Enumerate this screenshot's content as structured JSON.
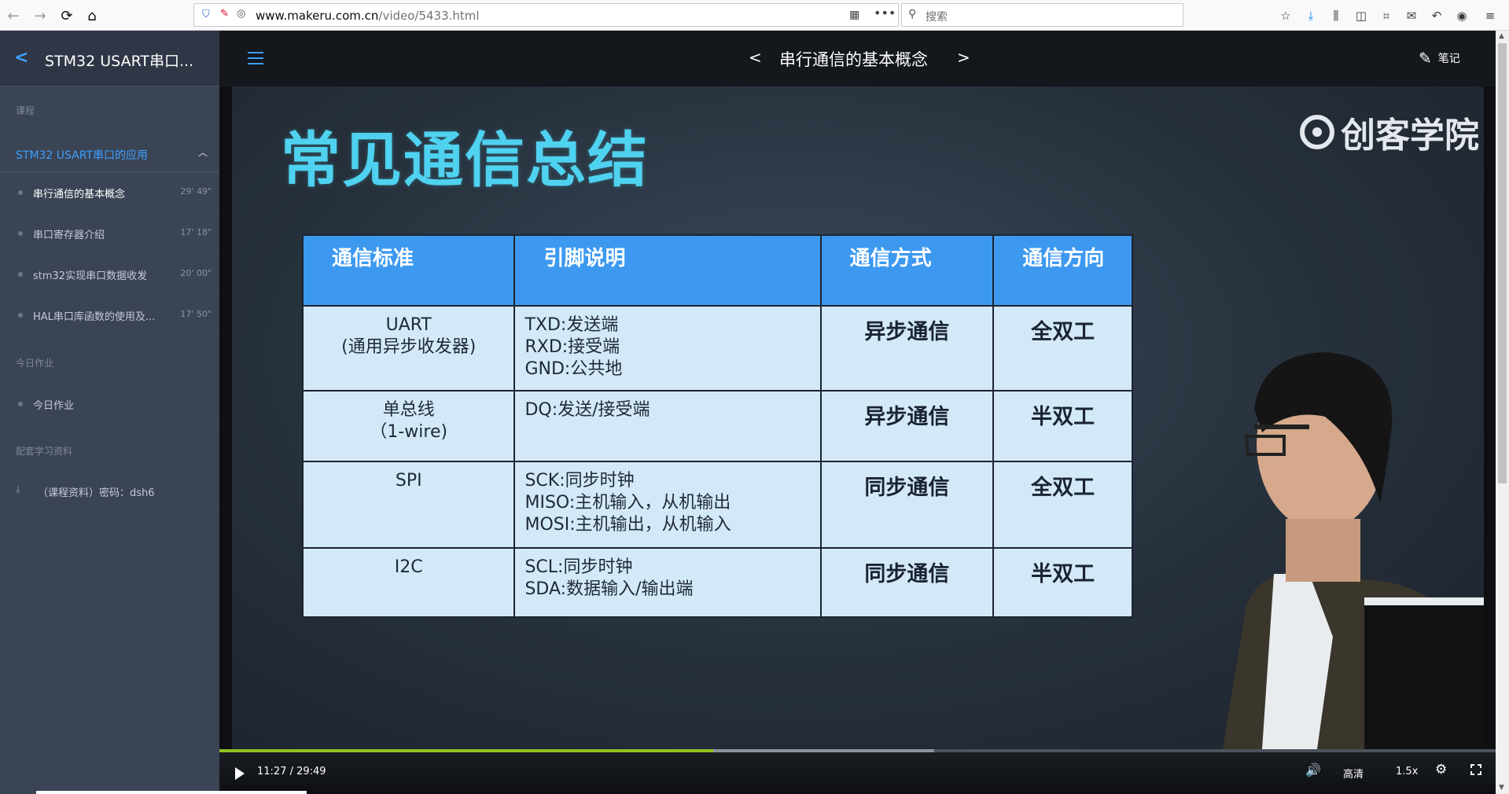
{
  "browser": {
    "url_host": "www.makeru.com.cn",
    "url_path": "/video/5433.html",
    "search_placeholder": "搜索"
  },
  "sidebar": {
    "title": "STM32 USART串口...",
    "section_course": "课程",
    "course_name": "STM32 USART串口的应用",
    "items": [
      {
        "label": "串行通信的基本概念",
        "duration": "29' 49\"",
        "active": true
      },
      {
        "label": "串口寄存器介绍",
        "duration": "17' 18\""
      },
      {
        "label": "stm32实现串口数据收发",
        "duration": "20' 00\""
      },
      {
        "label": "HAL串口库函数的使用及...",
        "duration": "17' 50\""
      }
    ],
    "section_homework": "今日作业",
    "homework_item": "今日作业",
    "section_materials": "配套学习资料",
    "material_item": "（课程资料）密码：dsh6"
  },
  "header": {
    "prev": "<",
    "lesson_title": "串行通信的基本概念",
    "next": ">",
    "notes_label": "笔记"
  },
  "slide": {
    "title": "常见通信总结",
    "brand": "创客学院",
    "headers": [
      "通信标准",
      "引脚说明",
      "通信方式",
      "通信方向"
    ],
    "rows": [
      {
        "std": [
          "UART",
          "(通用异步收发器)"
        ],
        "pins": [
          "TXD:发送端",
          "RXD:接受端",
          "GND:公共地"
        ],
        "mode": "异步通信",
        "dir": "全双工"
      },
      {
        "std": [
          "单总线",
          "（1-wire)"
        ],
        "pins": [
          "DQ:发送/接受端"
        ],
        "mode": "异步通信",
        "dir": "半双工"
      },
      {
        "std": [
          "SPI"
        ],
        "pins": [
          "SCK:同步时钟",
          "MISO:主机输入，从机输出",
          "MOSI:主机输出，从机输入"
        ],
        "mode": "同步通信",
        "dir": "全双工"
      },
      {
        "std": [
          "I2C"
        ],
        "pins": [
          "SCL:同步时钟",
          "SDA:数据输入/输出端"
        ],
        "mode": "同步通信",
        "dir": "半双工"
      }
    ]
  },
  "player": {
    "time": "11:27 / 29:49",
    "progress_fraction": 0.387,
    "quality": "高清",
    "speed": "1.5x"
  }
}
